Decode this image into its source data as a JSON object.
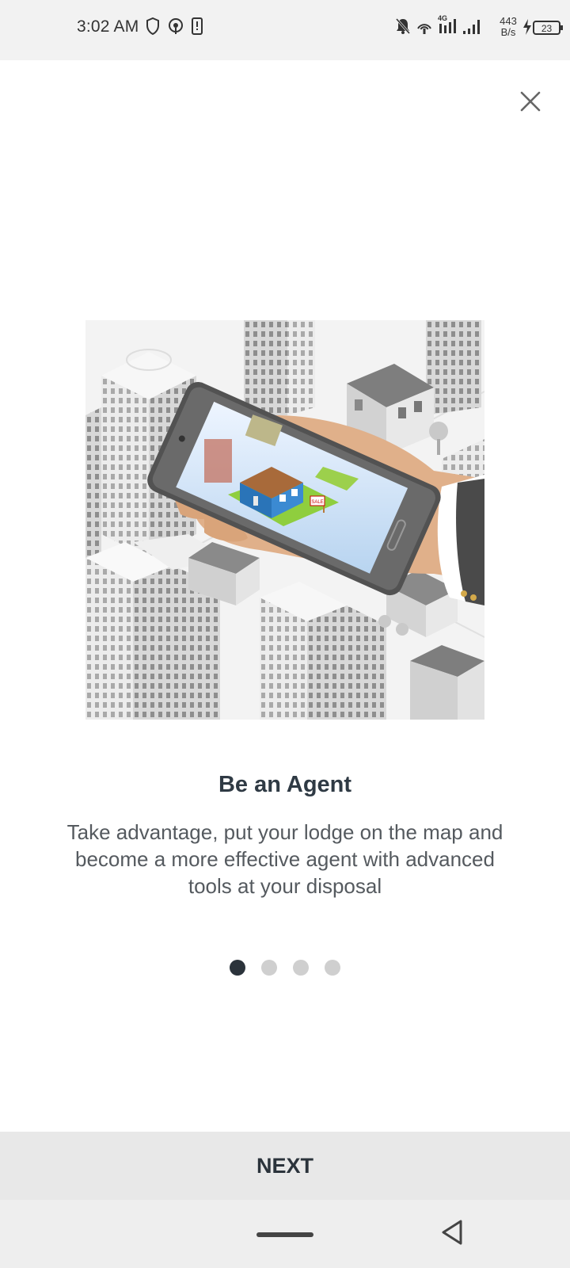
{
  "status_bar": {
    "time": "3:02 AM",
    "net_speed_value": "443",
    "net_speed_unit": "B/s",
    "battery_level": "23",
    "network_type": "4G"
  },
  "onboarding": {
    "title": "Be an Agent",
    "description": "Take advantage, put your lodge on the map and become a more effective agent with advanced tools at your disposal",
    "page_count": 4,
    "current_page": 1,
    "sale_sign_text": "SALE"
  },
  "actions": {
    "next_label": "NEXT"
  },
  "colors": {
    "dot_active": "#2b333b",
    "dot_inactive": "#cfcfcf",
    "button_bg": "#e8e8e8"
  }
}
